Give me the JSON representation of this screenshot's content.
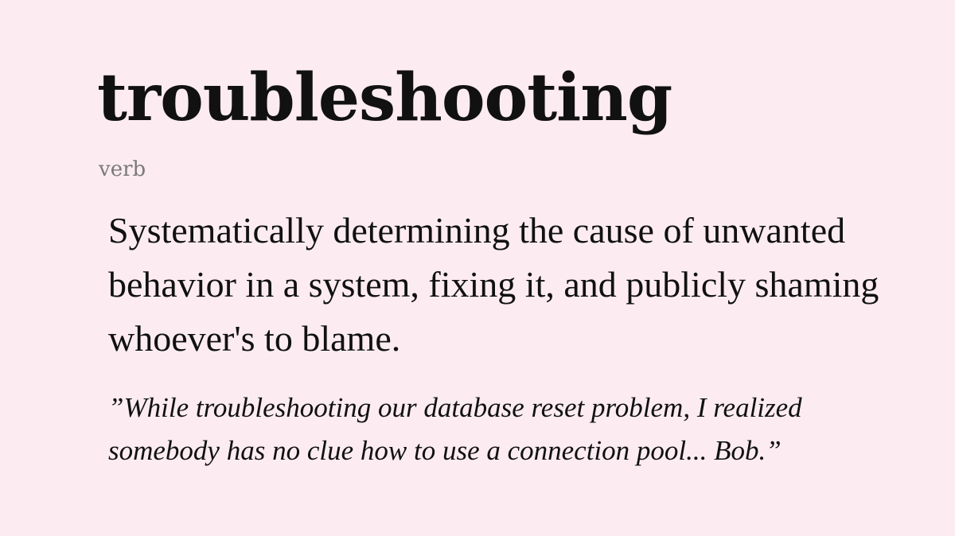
{
  "entry": {
    "word": "troubleshooting",
    "part_of_speech": "verb",
    "definition": "Systematically determining the cause of unwanted behavior in a system, fixing it, and publicly shaming whoever's to blame.",
    "example": "”While troubleshooting our database reset problem, I realized somebody has no clue how to use a connection pool... Bob.”"
  },
  "colors": {
    "background": "#fcecf1",
    "text": "#111111",
    "muted": "#7a7a7a"
  }
}
